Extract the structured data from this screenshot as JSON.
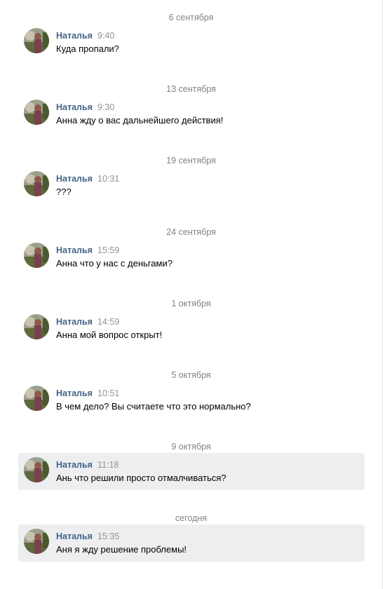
{
  "accent_colors": {
    "name": "#42648b",
    "meta": "#939393",
    "date": "#828282",
    "highlight": "#edeef0"
  },
  "avatar_icon": "user-photo-icon",
  "messages": [
    {
      "date": "6 сентября",
      "author": "Наталья",
      "time": "9:40",
      "text": "Куда пропали?"
    },
    {
      "date": "13 сентября",
      "author": "Наталья",
      "time": "9:30",
      "text": "Анна жду о вас дальнейшего действия!"
    },
    {
      "date": "19 сентября",
      "author": "Наталья",
      "time": "10:31",
      "text": "???"
    },
    {
      "date": "24 сентября",
      "author": "Наталья",
      "time": "15:59",
      "text": "Анна что у нас с деньгами?"
    },
    {
      "date": "1 октября",
      "author": "Наталья",
      "time": "14:59",
      "text": "Анна мой вопрос открыт!"
    },
    {
      "date": "5 октября",
      "author": "Наталья",
      "time": "10:51",
      "text": "В чем дело? Вы считаете что это нормально?"
    },
    {
      "date": "9 октября",
      "author": "Наталья",
      "time": "11:18",
      "text": "Ань что решили просто отмалчиваться?"
    },
    {
      "date": "сегодня",
      "author": "Наталья",
      "time": "15:35",
      "text": "Аня я жду решение проблемы!"
    }
  ]
}
